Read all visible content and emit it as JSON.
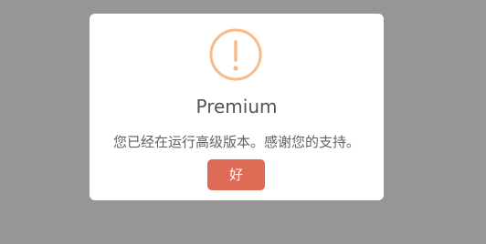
{
  "dialog": {
    "icon": "warning-icon",
    "icon_color": "#F8BB86",
    "title": "Premium",
    "message": "您已经在运行高级版本。感谢您的支持。",
    "ok_label": "好",
    "ok_color": "#DD6B55"
  }
}
